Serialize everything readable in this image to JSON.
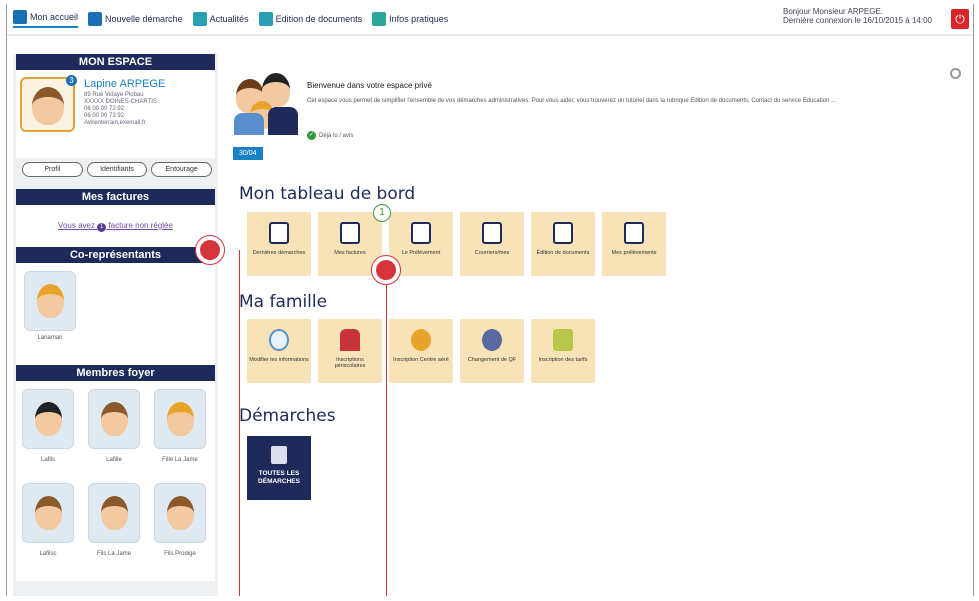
{
  "topnav": {
    "items": [
      {
        "label": "Mon accueil",
        "icon": "home-icon"
      },
      {
        "label": "Nouvelle démarche",
        "icon": "plus-icon"
      },
      {
        "label": "Actualités",
        "icon": "news-icon"
      },
      {
        "label": "Edition de documents",
        "icon": "document-icon"
      },
      {
        "label": "Infos pratiques",
        "icon": "lightbulb-icon"
      }
    ],
    "greeting": "Bonjour Monsieur ARPEGE.",
    "last_login": "Dernière connexion le 16/10/2015 à 14:00"
  },
  "sidebar": {
    "mon_espace": "MON ESPACE",
    "profile_name": "Lapine ARPEGE",
    "profile_info": [
      "89 Rue Vidaye Plobau",
      "XXXXX DOINES-CHARTIS",
      "06 00 00 72 92",
      "06 00 00 73 92",
      "Avirenterrain.exemail.fr"
    ],
    "badge": "3",
    "buttons": [
      "Profil",
      "Identifiants",
      "Entourage"
    ],
    "factures_title": "Mes factures",
    "factures_prefix": "Vous avez",
    "factures_count": "1",
    "factures_link": "facture non réglée",
    "corep_title": "Co-représentants",
    "corep": [
      {
        "name": "Lanaman"
      }
    ],
    "foyer_title": "Membres foyer",
    "foyer": [
      {
        "name": "Lafils"
      },
      {
        "name": "Lafille"
      },
      {
        "name": "Fille La Jame"
      },
      {
        "name": "Lafilsc"
      },
      {
        "name": "Fils La Jame"
      },
      {
        "name": "Fils Prodige"
      }
    ]
  },
  "welcome": {
    "date": "30/04",
    "title": "Bienvenue dans votre espace privé",
    "text": "Cet espace vous permet de simplifier l'ensemble de vos démarches administratives. Pour vous aider, vous trouverez un tutoriel dans la rubrique Edition de documents. Contact du service Education ...",
    "link": "Déjà lu / avis"
  },
  "tableau": {
    "title": "Mon tableau de bord",
    "notif": "1",
    "tiles": [
      "Dernières démarches",
      "Mes factures",
      "Le Prélèvement",
      "Courriers/mes",
      "Édition de documents",
      "Mes prélèvements"
    ]
  },
  "famille": {
    "title": "Ma famille",
    "tiles": [
      "Modifier les informations",
      "Inscriptions périscolaires",
      "Inscription Centre aéré",
      "Changement de QF",
      "Inscription des tarifs"
    ]
  },
  "demarches": {
    "title": "Démarches",
    "tile": "TOUTES LES DÉMARCHES"
  },
  "colors": {
    "navy": "#1e2a5a",
    "accent": "#1a82c4",
    "tile": "#f8e3b8",
    "marker": "#d6343c"
  }
}
